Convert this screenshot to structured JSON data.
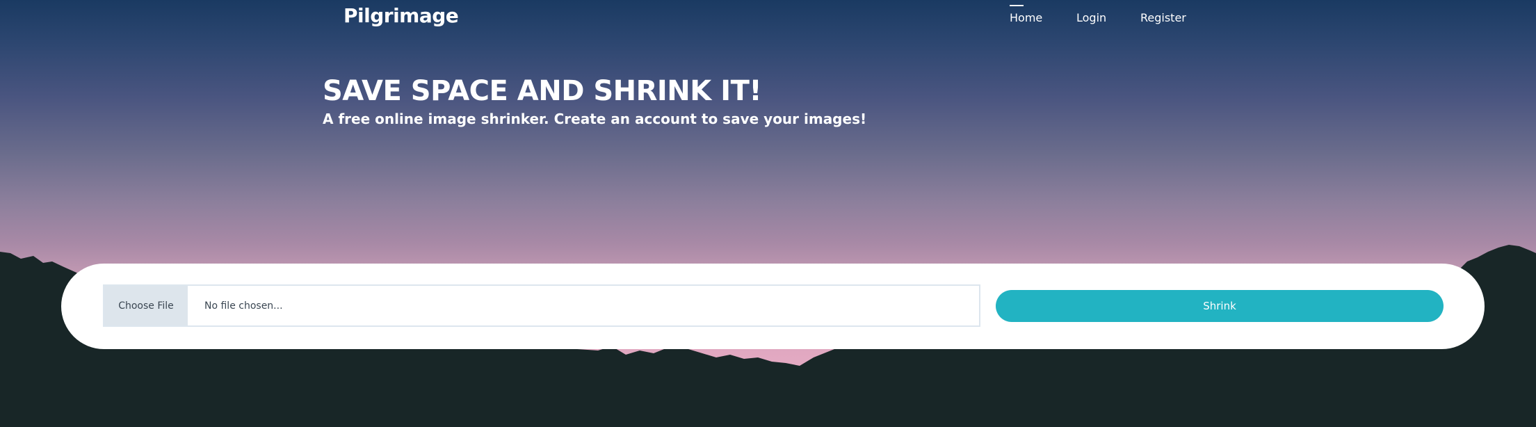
{
  "brand": {
    "logo_text": "Pilgrimage"
  },
  "nav": {
    "items": [
      {
        "label": "Home",
        "active": true
      },
      {
        "label": "Login",
        "active": false
      },
      {
        "label": "Register",
        "active": false
      }
    ]
  },
  "hero": {
    "title": "SAVE SPACE AND SHRINK IT!",
    "subtitle": "A free online image shrinker. Create an account to save your images!"
  },
  "upload": {
    "choose_label": "Choose File",
    "file_status": "No file chosen...",
    "submit_label": "Shrink"
  },
  "colors": {
    "accent": "#22b3c2",
    "sky_top": "#1a3a62",
    "sky_bottom": "#e3a9c2",
    "mountains": "#182627"
  }
}
